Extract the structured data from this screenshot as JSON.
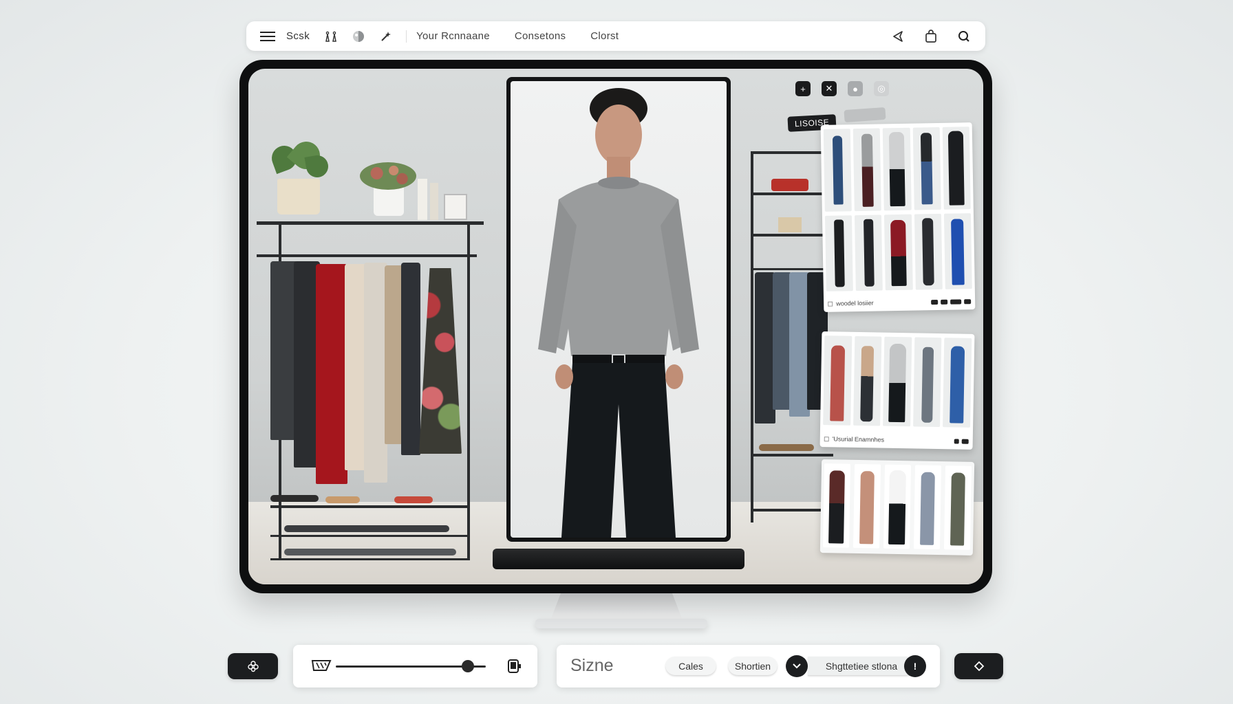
{
  "topbar": {
    "menu_icon": "hamburger-menu-icon",
    "app_label": "Scsk",
    "links": [
      "Your Rcnnaane",
      "Consetons",
      "Clorst"
    ],
    "right_icons": [
      "share-icon",
      "bag-icon",
      "search-icon"
    ]
  },
  "panel": {
    "tag_label": "LISOISE",
    "card1_footer": "woodel losiier",
    "card2_footer": "'Usurial Enamnhes"
  },
  "bottombar": {
    "size_label": "Sizne",
    "pill_1": "Cales",
    "pill_2": "Shortien",
    "dropdown_label": "Shgttetiee stlona",
    "dropdown_action": "!",
    "slider_level": 0.88
  },
  "colors": {
    "accent": "#1c1e20",
    "sweater": "#9a9c9d",
    "pants": "#15191c"
  }
}
